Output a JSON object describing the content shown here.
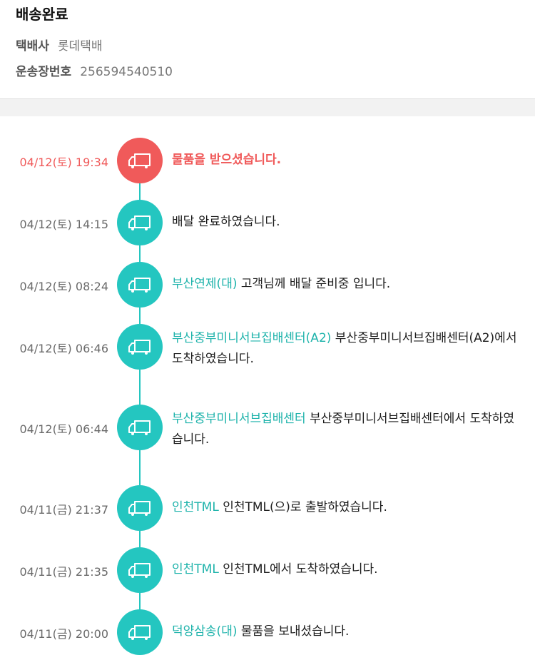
{
  "header": {
    "status_title": "배송완료",
    "carrier_label": "택배사",
    "carrier_value": "롯데택배",
    "tracking_label": "운송장번호",
    "tracking_value": "256594540510"
  },
  "colors": {
    "accent": "#24c6c0",
    "highlight": "#f05a5a",
    "location_text": "#1eb3ab"
  },
  "events": [
    {
      "time": "04/12(토) 19:34",
      "location": "",
      "message": "물품을 받으셨습니다.",
      "highlight": true,
      "icon": "truck-icon"
    },
    {
      "time": "04/12(토) 14:15",
      "location": "",
      "message": "배달 완료하였습니다.",
      "icon": "truck-icon"
    },
    {
      "time": "04/12(토) 08:24",
      "location": "부산연제(대)",
      "message": "고객님께 배달 준비중 입니다.",
      "icon": "truck-icon"
    },
    {
      "time": "04/12(토) 06:46",
      "location": "부산중부미니서브집배센터(A2)",
      "message": "부산중부미니서브집배센터(A2)에서 도착하였습니다.",
      "icon": "truck-icon"
    },
    {
      "time": "04/12(토) 06:44",
      "location": "부산중부미니서브집배센터",
      "message": "부산중부미니서브집배센터에서 도착하였습니다.",
      "icon": "truck-icon"
    },
    {
      "time": "04/11(금) 21:37",
      "location": "인천TML",
      "message": "인천TML(으)로 출발하였습니다.",
      "icon": "truck-icon"
    },
    {
      "time": "04/11(금) 21:35",
      "location": "인천TML",
      "message": "인천TML에서 도착하였습니다.",
      "icon": "truck-icon"
    },
    {
      "time": "04/11(금) 20:00",
      "location": "덕양삼송(대)",
      "message": "물품을 보내셨습니다.",
      "icon": "truck-icon"
    }
  ]
}
